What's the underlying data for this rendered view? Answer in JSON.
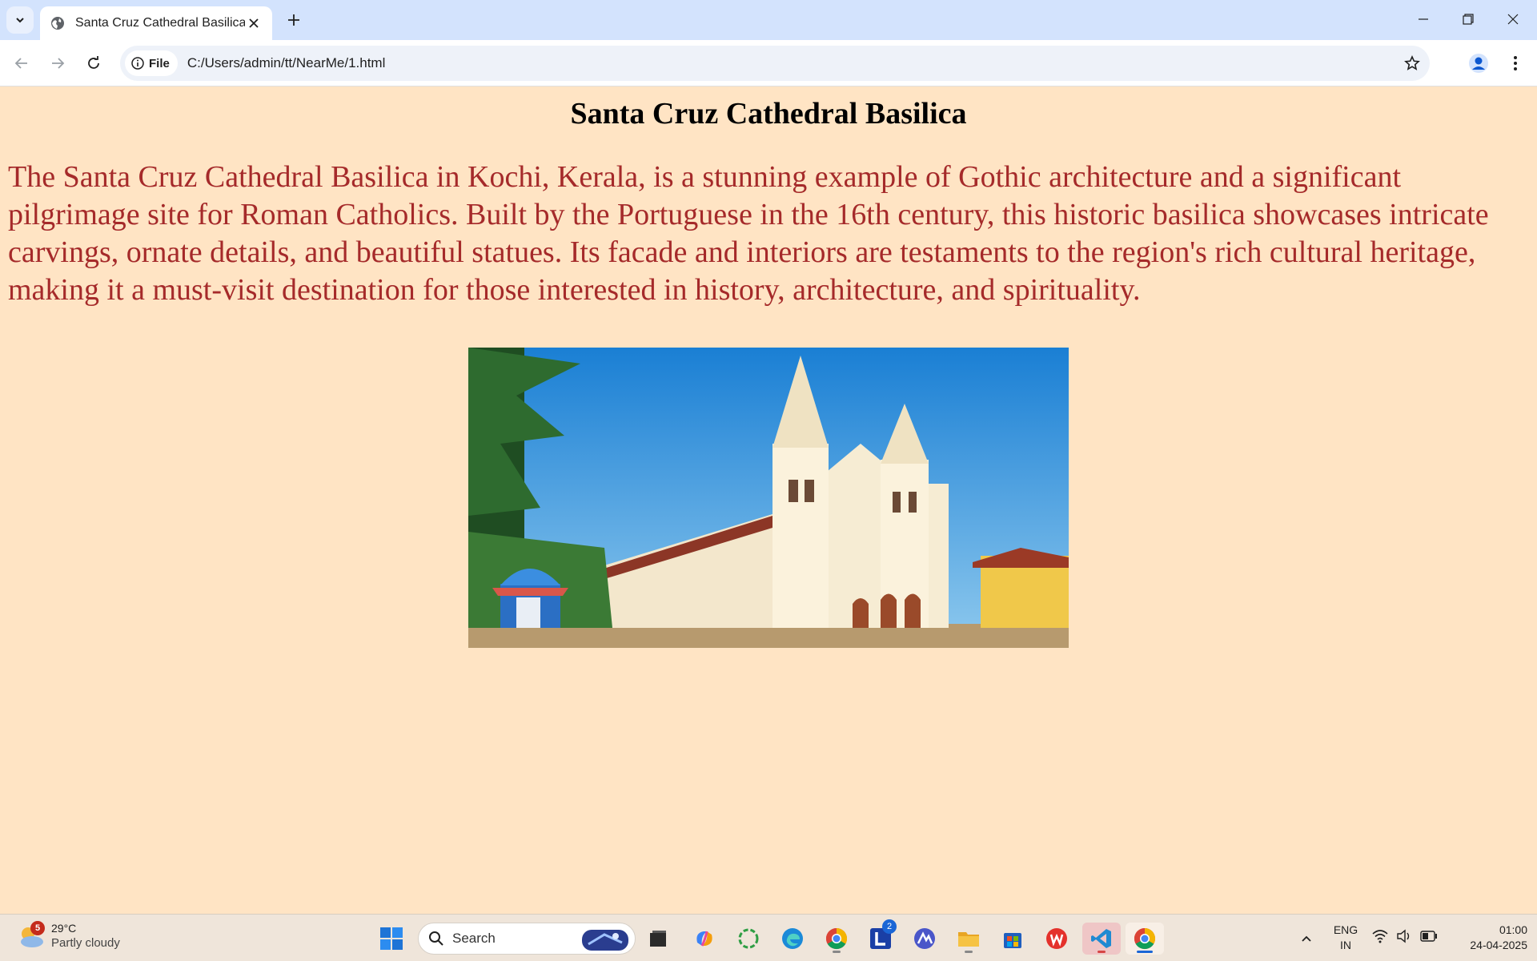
{
  "browser": {
    "tab": {
      "title": "Santa Cruz Cathedral Basilica"
    },
    "omnibox": {
      "chip_label": "File",
      "url": "C:/Users/admin/tt/NearMe/1.html"
    }
  },
  "page": {
    "heading": "Santa Cruz Cathedral Basilica",
    "paragraph": "The Santa Cruz Cathedral Basilica in Kochi, Kerala, is a stunning example of Gothic architecture and a significant pilgrimage site for Roman Catholics. Built by the Portuguese in the 16th century, this historic basilica showcases intricate carvings, ornate details, and beautiful statues. Its facade and interiors are testaments to the region's rich cultural heritage, making it a must-visit destination for those interested in history, architecture, and spirituality.",
    "colors": {
      "background": "#ffe4c4",
      "paragraph": "#a52a2a",
      "heading": "#000000"
    }
  },
  "taskbar": {
    "weather": {
      "badge": "5",
      "temperature": "29°C",
      "condition": "Partly cloudy"
    },
    "search_label": "Search",
    "apps": [
      "windows-start",
      "search",
      "file-explorer-dark",
      "copilot",
      "refresh-app",
      "edge",
      "chrome",
      "l-app",
      "vpn-app",
      "folder",
      "store",
      "wps-office",
      "vscode",
      "chrome-active"
    ],
    "l_app_badge": "2",
    "language": {
      "line1": "ENG",
      "line2": "IN"
    },
    "clock": {
      "time": "01:00",
      "date": "24-04-2025"
    }
  }
}
